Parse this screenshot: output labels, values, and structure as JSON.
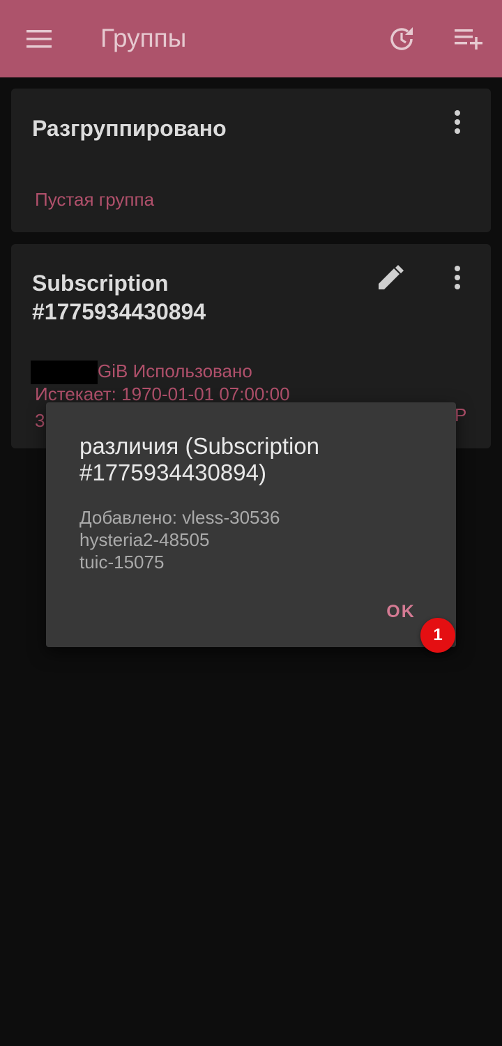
{
  "appbar": {
    "title": "Группы",
    "menu_icon": "menu-icon",
    "update_icon": "update-history-icon",
    "add_icon": "playlist-add-icon",
    "background": "#ad536b"
  },
  "groups": [
    {
      "name": "Разгруппировано",
      "status": "Пустая группа"
    },
    {
      "name_line1": "Subscription",
      "name_line2": "#1775934430894",
      "usage": "GiB Использовано",
      "expires": "Истекает: 1970-01-01 07:00:00",
      "partial_left": "3",
      "partial_right": "Р"
    }
  ],
  "dialog": {
    "title": "различия (Subscription #1775934430894)",
    "message_lines": [
      "Добавлено: vless-30536",
      "hysteria2-48505",
      "tuic-15075"
    ],
    "ok_label": "OK"
  },
  "badge": {
    "label": "1",
    "color": "#e40f12"
  },
  "accent": "#b0506b"
}
